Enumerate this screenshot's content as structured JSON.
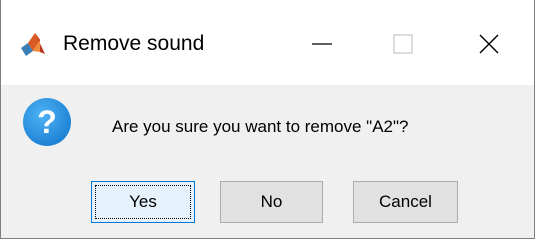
{
  "window": {
    "title": "Remove sound",
    "app_icon": "matlab-icon",
    "controls": {
      "minimize_icon": "minimize-icon",
      "maximize_icon": "maximize-icon",
      "close_icon": "close-icon"
    }
  },
  "dialog": {
    "icon": "question-icon",
    "message": "Are you sure you want to remove \"A2\"?",
    "buttons": {
      "yes": "Yes",
      "no": "No",
      "cancel": "Cancel"
    },
    "focused_button": "yes"
  },
  "colors": {
    "title_bg": "#ffffff",
    "body_bg": "#f0f0f0",
    "question_icon": "#1e90e6",
    "button_bg": "#e1e1e1",
    "focused_button_bg": "#e5f1fb",
    "focused_button_border": "#0078d7"
  }
}
